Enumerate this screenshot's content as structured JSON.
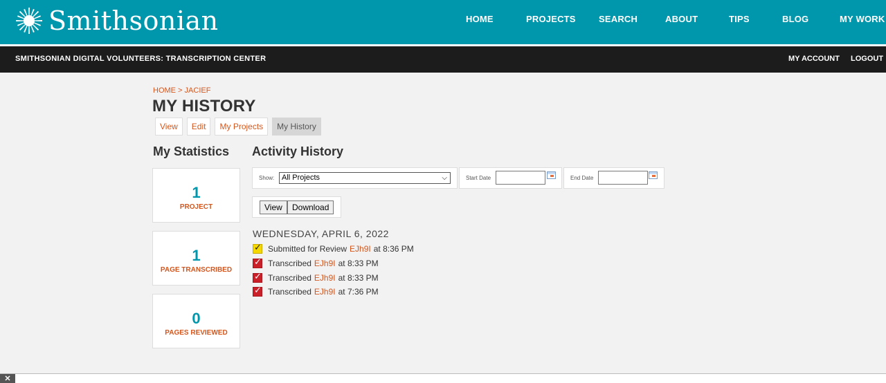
{
  "header": {
    "logo_text": "Smithsonian",
    "nav": [
      "HOME",
      "PROJECTS",
      "SEARCH",
      "ABOUT",
      "TIPS",
      "BLOG",
      "MY WORK"
    ]
  },
  "subheader": {
    "site_title": "SMITHSONIAN DIGITAL VOLUNTEERS: TRANSCRIPTION CENTER",
    "my_account": "MY ACCOUNT",
    "logout": "LOGOUT"
  },
  "breadcrumb": {
    "home": "HOME",
    "separator": " > ",
    "user": "JACIEF"
  },
  "page_title": "MY HISTORY",
  "tabs": [
    {
      "label": "View",
      "active": false
    },
    {
      "label": "Edit",
      "active": false
    },
    {
      "label": "My Projects",
      "active": false
    },
    {
      "label": "My History",
      "active": true
    }
  ],
  "statistics": {
    "title": "My Statistics",
    "items": [
      {
        "value": "1",
        "label": "PROJECT"
      },
      {
        "value": "1",
        "label": "PAGE TRANSCRIBED"
      },
      {
        "value": "0",
        "label": "PAGES REVIEWED"
      }
    ]
  },
  "activity": {
    "title": "Activity History",
    "show_label": "Show:",
    "show_value": "All Projects",
    "start_date_label": "Start Date",
    "start_date_value": "",
    "end_date_label": "End Date",
    "end_date_value": "",
    "view_button": "View",
    "download_button": "Download",
    "day_heading": "WEDNESDAY, APRIL 6, 2022",
    "items": [
      {
        "status": "yellow",
        "action": "Submitted for Review",
        "project": "EJh9I",
        "time": "at 8:36 PM"
      },
      {
        "status": "red",
        "action": "Transcribed",
        "project": "EJh9I",
        "time": "at 8:33 PM"
      },
      {
        "status": "red",
        "action": "Transcribed",
        "project": "EJh9I",
        "time": "at 8:33 PM"
      },
      {
        "status": "red",
        "action": "Transcribed",
        "project": "EJh9I",
        "time": "at 7:36 PM"
      }
    ]
  },
  "colors": {
    "header_teal": "#0097ac",
    "subheader_black": "#1c1c1c",
    "accent_orange": "#d4561c",
    "check_yellow": "#f5d800",
    "check_red": "#c9202a"
  },
  "bottom": {
    "close_label": "✕"
  }
}
